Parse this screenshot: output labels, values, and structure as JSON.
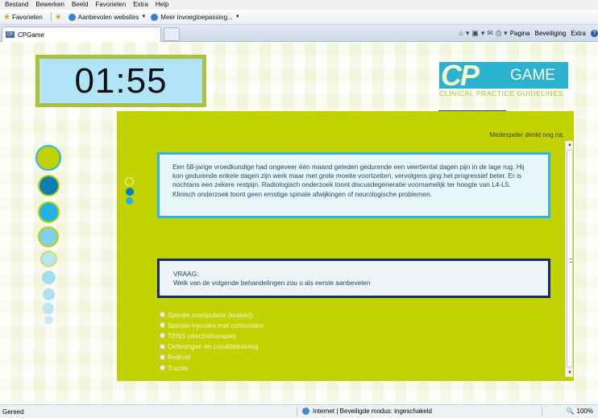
{
  "browser": {
    "menu": [
      "Bestand",
      "Bewerken",
      "Beeld",
      "Favorieten",
      "Extra",
      "Help"
    ],
    "favorites_label": "Favorieten",
    "suggested_sites": "Aanbevolen websites",
    "addons": "Meer invoegtoepassing...",
    "tab_title": "CPGame",
    "tools": {
      "page": "Pagina",
      "security": "Beveiliging",
      "extra": "Extra"
    },
    "status": {
      "ready": "Gereed",
      "zone": "Internet | Beveiligde modus: ingeschakeld",
      "zoom": "100%"
    }
  },
  "game": {
    "timer": "01:55",
    "logo": {
      "cp": "CP",
      "game": "GAME",
      "subtitle": "CLINICAL PRACTICE GUIDELINES"
    },
    "progress_fraction": 0.27,
    "opponent_status": "Medespeler denkt nog na.",
    "scenario": "Een 58-jarige vroedkundige had ongeveer één maand geleden gedurende een veertiental dagen pijn in de lage rug. Hij kon gedurende enkele dagen zijn werk maar met grote moeite voortzetten, vervolgens ging het progressief beter. Er is nochtans een zekere restpijn. Radiologisch onderzoek toont discusdegeneratie voornamelijk ter hoogte van L4-L5. Klinisch onderzoek toont geen ernstige spinale afwijkingen of neurologische problemen.",
    "question_heading": "VRAAG:",
    "question": "Welk van de volgende behandelingen zou u als eerste aanbevelen",
    "options": [
      "Spinale manipulatie (kraken)",
      "Spinale injecties met corticoïden",
      "TENS (electrotherapie)",
      "Oefeningen en conditietraining",
      "Bedrust",
      "Tractie"
    ],
    "colors": {
      "panel": "#c2d100",
      "timer_border": "#a9c13d",
      "timer_bg": "#b1e4f7",
      "scenario_border": "#2eb5e5",
      "question_border": "#162b6f"
    }
  }
}
